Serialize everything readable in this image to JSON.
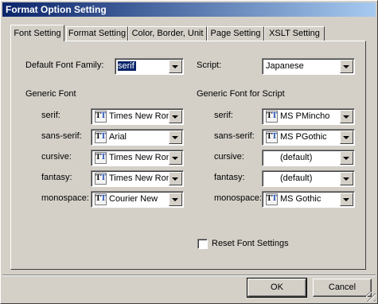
{
  "window": {
    "title": "Format Option Setting"
  },
  "tabs": [
    {
      "label": "Font Setting",
      "active": true
    },
    {
      "label": "Format Setting",
      "active": false
    },
    {
      "label": "Color, Border, Unit",
      "active": false
    },
    {
      "label": "Page Setting",
      "active": false
    },
    {
      "label": "XSLT Setting",
      "active": false
    }
  ],
  "font_setting": {
    "default_family": {
      "label": "Default Font Family:",
      "mnemonic": "F",
      "value": "serif"
    },
    "script": {
      "label": "Script:",
      "mnemonic": "S",
      "value": "Japanese"
    },
    "generic_font": {
      "heading": "Generic Font",
      "rows": [
        {
          "label": "serif:",
          "value": "Times New Roman"
        },
        {
          "label": "sans-serif:",
          "value": "Arial"
        },
        {
          "label": "cursive:",
          "value": "Times New Roman"
        },
        {
          "label": "fantasy:",
          "value": "Times New Roman"
        },
        {
          "label": "monospace:",
          "value": "Courier New"
        }
      ]
    },
    "script_font": {
      "heading": "Generic Font for Script",
      "rows": [
        {
          "label": "serif:",
          "value": "MS PMincho",
          "icon": true
        },
        {
          "label": "sans-serif:",
          "value": "MS PGothic",
          "icon": true
        },
        {
          "label": "cursive:",
          "value": "(default)",
          "icon": false
        },
        {
          "label": "fantasy:",
          "value": "(default)",
          "icon": false
        },
        {
          "label": "monospace:",
          "value": "MS Gothic",
          "icon": true
        }
      ]
    },
    "reset": {
      "label": "Reset Font Settings",
      "checked": false
    }
  },
  "buttons": {
    "ok": "OK",
    "cancel": "Cancel"
  },
  "icons": {
    "truetype_font": "truetype-font-icon"
  },
  "colors": {
    "title_start": "#0a246a",
    "title_end": "#a6caf0",
    "face": "#d4d0c8",
    "selection": "#0a246a"
  }
}
